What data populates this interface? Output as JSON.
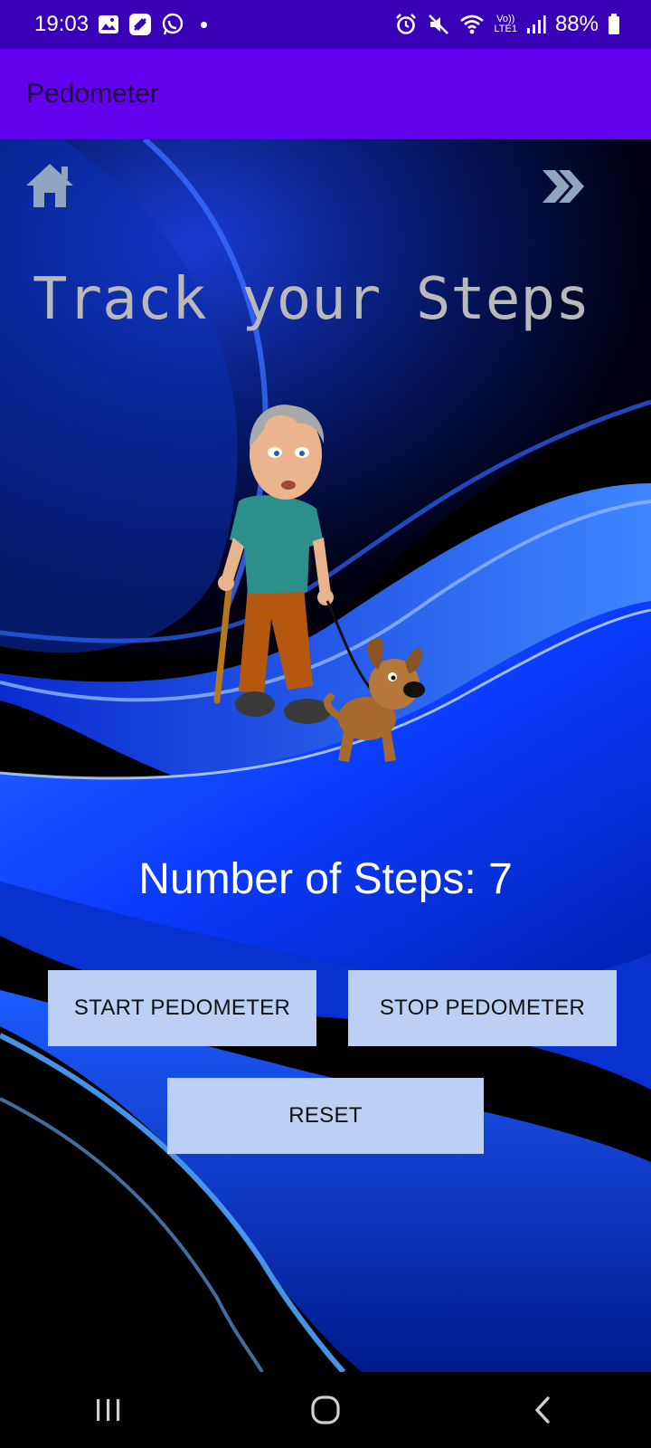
{
  "status_bar": {
    "time": "19:03",
    "left_icons": [
      "gallery-icon",
      "flipboard-icon",
      "whatsapp-icon"
    ],
    "right_icons": [
      "alarm-icon",
      "mute-icon",
      "wifi-icon",
      "volte-lte-icon",
      "signal-icon"
    ],
    "volte_label_top": "Vo))",
    "volte_label_bottom": "LTE1",
    "battery": "88%"
  },
  "app_bar": {
    "title": "Pedometer",
    "color": "#6200ee"
  },
  "main": {
    "home_icon": "home-icon",
    "next_icon": "double-chevron-right-icon",
    "headline": "Track your Steps",
    "steps_label": "Number of Steps: 7",
    "steps_value": 7
  },
  "buttons": {
    "start": "START PEDOMETER",
    "stop": "STOP PEDOMETER",
    "reset": "RESET",
    "color": "#bcd0f6"
  },
  "nav_bar": {
    "icons": [
      "recent-apps-icon",
      "home-circle-icon",
      "back-icon"
    ]
  }
}
